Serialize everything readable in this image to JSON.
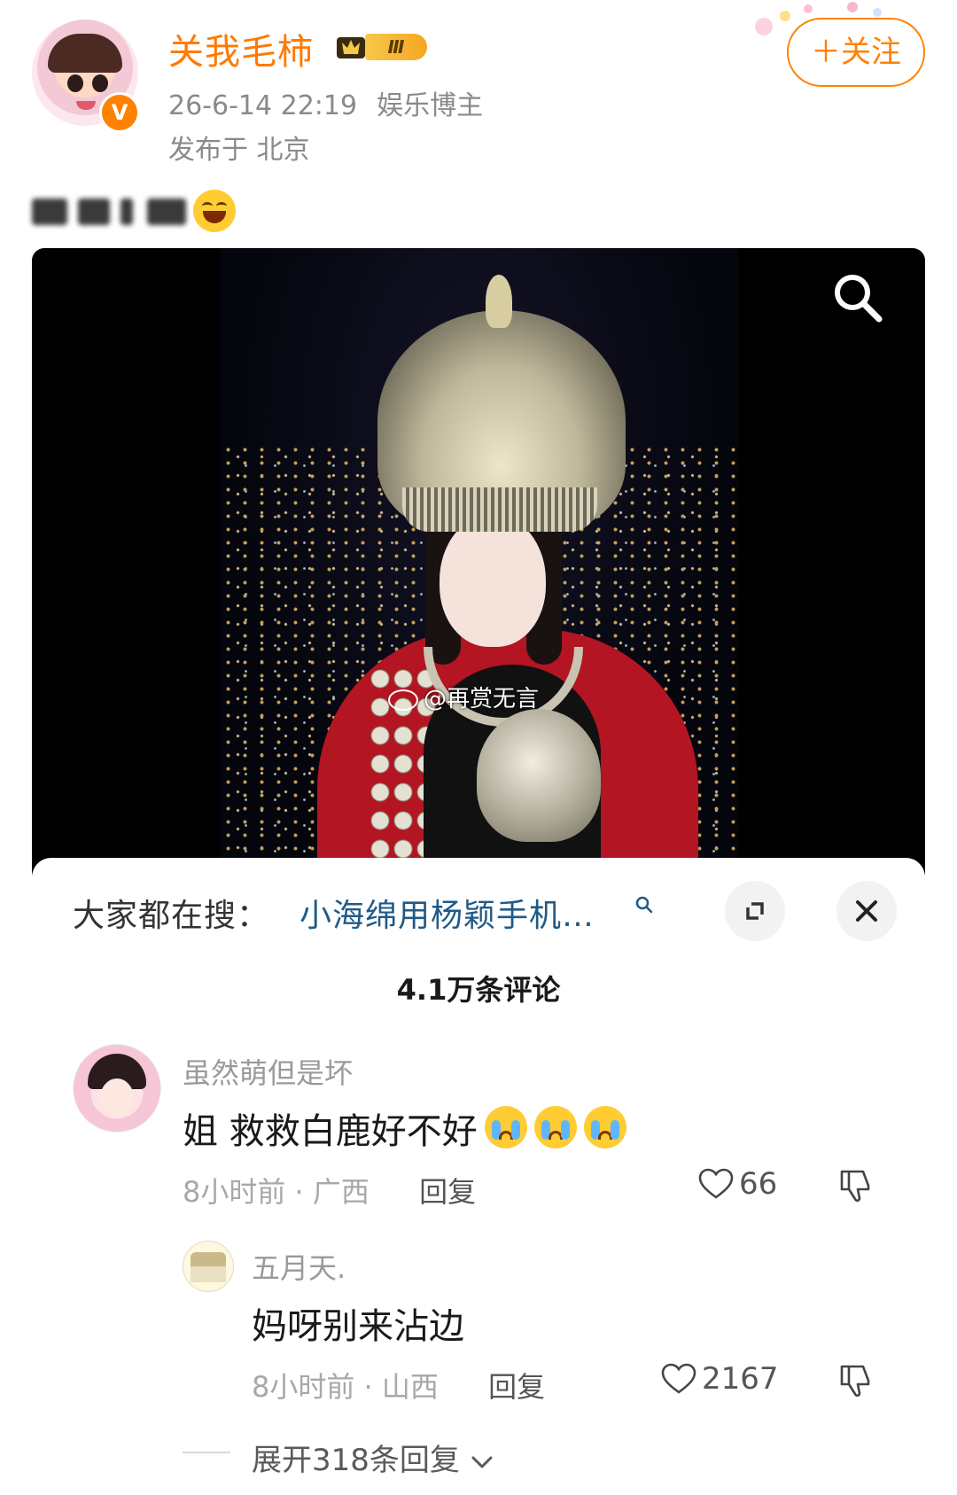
{
  "post": {
    "username": "关我毛柿",
    "level_badge": "Ⅲ",
    "timestamp": "26-6-14 22:19",
    "user_tag": "娱乐博主",
    "location": "发布于 北京",
    "follow_label": "＋关注",
    "verified_mark": "V"
  },
  "media": {
    "watermark": "@再赏无言"
  },
  "hot_search": {
    "label": "大家都在搜：",
    "term": "小海绵用杨颖手机…"
  },
  "comments": {
    "count_label": "4.1万条评论",
    "items": [
      {
        "name": "虽然萌但是坏",
        "text": "姐 救救白鹿好不好",
        "time": "8小时前",
        "region": "广西",
        "reply_label": "回复",
        "likes": "66"
      }
    ],
    "reply": {
      "name": "五月天.",
      "text": "妈呀别来沾边",
      "time": "8小时前",
      "region": "山西",
      "reply_label": "回复",
      "likes": "2167"
    },
    "expand_label": "展开318条回复"
  },
  "colors": {
    "brand_orange": "#ff8200",
    "username": "#ff7a00",
    "link_blue": "#1f5a86"
  }
}
